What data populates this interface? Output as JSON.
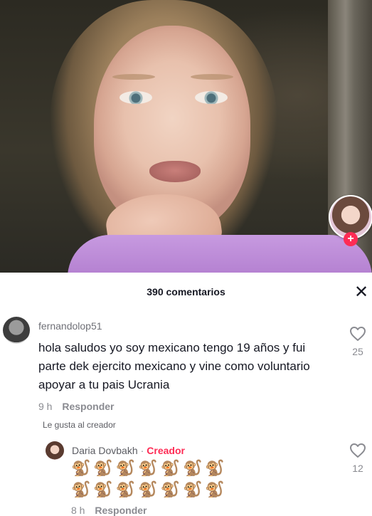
{
  "video": {
    "creator_avatar_icon": "creator-avatar",
    "follow_icon": "plus-icon",
    "follow_symbol": "+"
  },
  "comments_panel": {
    "title": "390 comentarios",
    "close_symbol": "✕",
    "accent_color": "#fe2c55",
    "comments": [
      {
        "username": "fernandolop51",
        "text": "hola saludos yo soy mexicano tengo 19 años y fui parte dek ejercito mexicano y vine como voluntario apoyar a tu pais Ucrania",
        "time": "9 h",
        "reply_label": "Responder",
        "liked_by_creator": "Le gusta al creador",
        "likes": "25",
        "reply": {
          "username": "Daria Dovbakh",
          "separator": "·",
          "badge": "Creador",
          "emoji_line_1": "🐒🐒🐒🐒🐒🐒🐒",
          "emoji_line_2": "🐒🐒🐒🐒🐒🐒🐒",
          "time": "8 h",
          "reply_label": "Responder",
          "likes": "12"
        }
      }
    ]
  }
}
